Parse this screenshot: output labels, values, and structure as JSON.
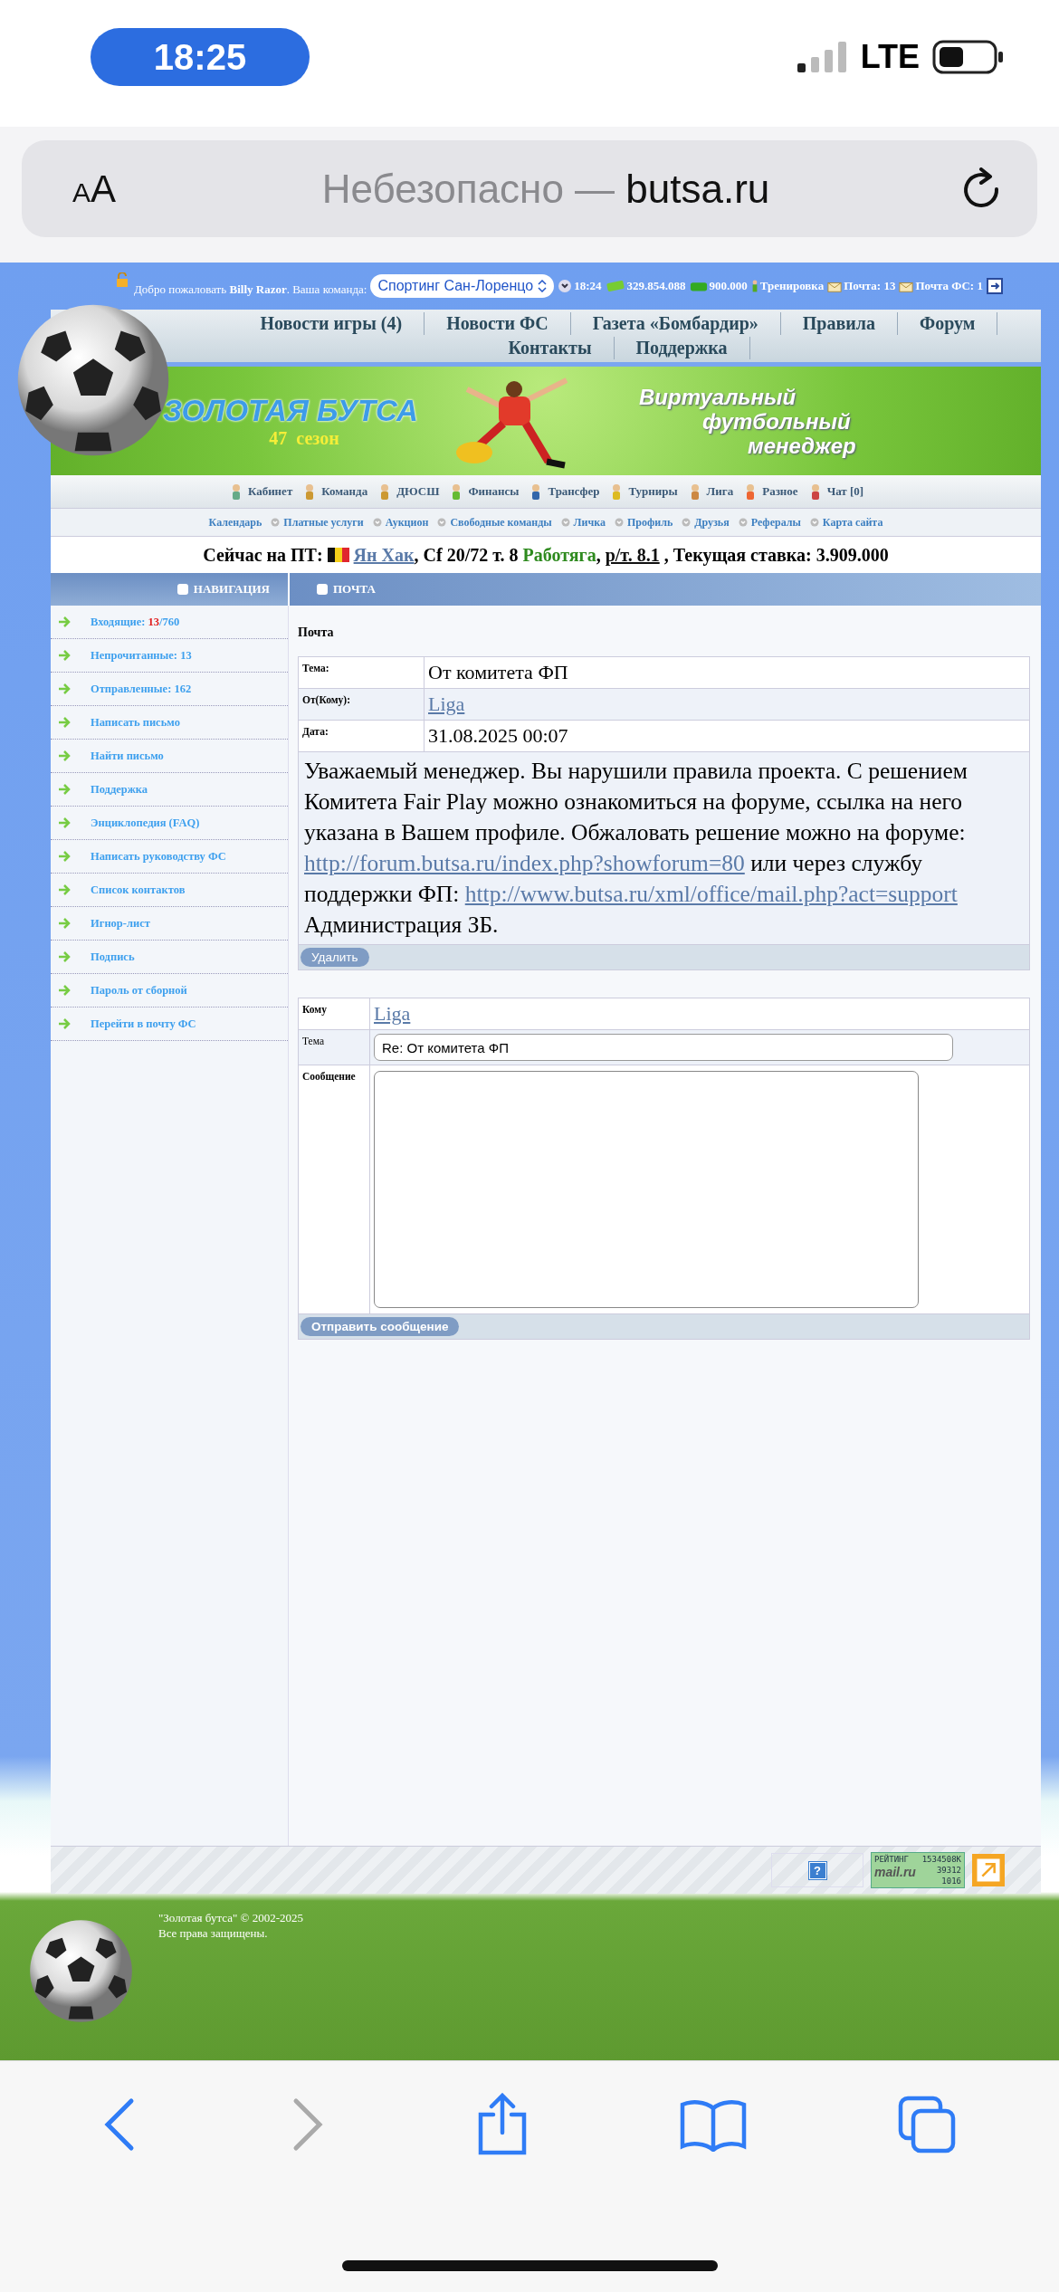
{
  "status_bar": {
    "time": "18:25",
    "network": "LTE"
  },
  "browser": {
    "text_size": "AA",
    "security": "Небезопасно —",
    "domain": "butsa.ru"
  },
  "topbar": {
    "welcome": "Добро пожаловать",
    "user": "Billy Razor",
    "team_label": ". Ваша команда:",
    "team": "Спортинг Сан-Лоренцо",
    "time": "18:24",
    "money": "329.854.088",
    "bonus": "900.000",
    "training": "Тренировка",
    "mail": "Почта: 13",
    "mail_fs": "Почта ФС: 1"
  },
  "main_nav": [
    "Новости игры (4)",
    "Новости ФС",
    "Газета «Бомбардир»",
    "Правила",
    "Форум",
    "Контакты",
    "Поддержка"
  ],
  "banner": {
    "title": "ЗОЛОТАЯ БУТСА",
    "season": "47  сезон",
    "tagline": [
      "Виртуальный",
      "футбольный",
      "менеджер"
    ]
  },
  "icon_menu": [
    "Кабинет",
    "Команда",
    "ДЮСШ",
    "Финансы",
    "Трансфер",
    "Турниры",
    "Лига",
    "Разное",
    "Чат [0]"
  ],
  "link_menu": [
    "Календарь",
    "Платные услуги",
    "Аукцион",
    "Свободные команды",
    "Личка",
    "Профиль",
    "Друзья",
    "Рефералы",
    "Карта сайта"
  ],
  "transfer_line": {
    "label": "Сейчас на ПТ:",
    "player": "Ян Хак",
    "details": ", Cf 20/72 т. 8",
    "trait": "Работяга",
    "trait_separator": ",",
    "rating": "р/т. 8.1",
    "bid": ", Текущая ставка: 3.909.000"
  },
  "sidebar": {
    "title": "НАВИГАЦИЯ",
    "items": [
      {
        "label": "Входящие:",
        "unread": "13",
        "total": "/760"
      },
      {
        "label": "Непрочитанные: 13"
      },
      {
        "label": "Отправленные: 162"
      },
      {
        "label": "Написать письмо"
      },
      {
        "label": "Найти письмо"
      },
      {
        "label": "Поддержка"
      },
      {
        "label": "Энциклопедия (FAQ)"
      },
      {
        "label": "Написать руководству ФС"
      },
      {
        "label": "Список контактов"
      },
      {
        "label": "Игнор-лист"
      },
      {
        "label": "Подпись"
      },
      {
        "label": "Пароль от сборной"
      },
      {
        "label": "Перейти в почту ФС"
      }
    ]
  },
  "mail": {
    "header": "ПОЧТА",
    "title": "Почта",
    "fields": [
      {
        "label": "Тема:",
        "value": "От комитета ФП",
        "kind": "text"
      },
      {
        "label": "От(Кому):",
        "value": "Liga",
        "kind": "link"
      },
      {
        "label": "Дата:",
        "value": "31.08.2025 00:07",
        "kind": "text"
      }
    ],
    "body": [
      {
        "kind": "text",
        "text": "Уважаемый менеджер. Вы нарушили правила проекта. С решением Комитета Fair Play можно ознакомиться на форуме, ссылка на него указана в Вашем профиле. Обжаловать решение можно на форуме: "
      },
      {
        "kind": "link",
        "text": "http://forum.butsa.ru/index.php?showforum=80"
      },
      {
        "kind": "text",
        "text": " или через службу поддержки ФП: "
      },
      {
        "kind": "link",
        "text": "http://www.butsa.ru/xml/office/mail.php?act=support"
      },
      {
        "kind": "text",
        "text": " Администрация ЗБ."
      }
    ],
    "delete_button": "Удалить"
  },
  "reply": {
    "rows": [
      {
        "label": "Кому",
        "kind": "link",
        "value": "Liga"
      },
      {
        "label": "Тема",
        "kind": "input",
        "value": "Re: От комитета ФП"
      },
      {
        "label": "Сообщение",
        "kind": "textarea"
      }
    ],
    "send_button": "Отправить сообщение"
  },
  "footer": {
    "help": "?",
    "counter_label": "РЕЙТИНГ",
    "counter_brand": "mail.ru",
    "counter_values": [
      "1534508K",
      "39312",
      "1016"
    ],
    "copyright": "\"Золотая бутса\" © 2002-2025",
    "rights": "Все права защищены."
  }
}
